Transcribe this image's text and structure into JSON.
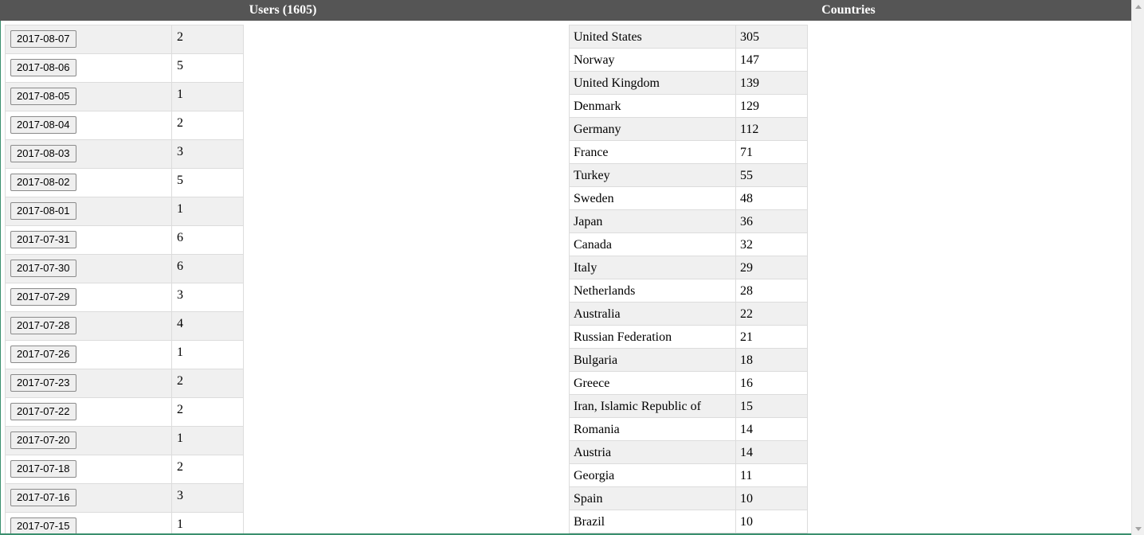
{
  "header": {
    "users_title": "Users (1605)",
    "countries_title": "Countries"
  },
  "users": [
    {
      "date": "2017-08-07",
      "count": "2"
    },
    {
      "date": "2017-08-06",
      "count": "5"
    },
    {
      "date": "2017-08-05",
      "count": "1"
    },
    {
      "date": "2017-08-04",
      "count": "2"
    },
    {
      "date": "2017-08-03",
      "count": "3"
    },
    {
      "date": "2017-08-02",
      "count": "5"
    },
    {
      "date": "2017-08-01",
      "count": "1"
    },
    {
      "date": "2017-07-31",
      "count": "6"
    },
    {
      "date": "2017-07-30",
      "count": "6"
    },
    {
      "date": "2017-07-29",
      "count": "3"
    },
    {
      "date": "2017-07-28",
      "count": "4"
    },
    {
      "date": "2017-07-26",
      "count": "1"
    },
    {
      "date": "2017-07-23",
      "count": "2"
    },
    {
      "date": "2017-07-22",
      "count": "2"
    },
    {
      "date": "2017-07-20",
      "count": "1"
    },
    {
      "date": "2017-07-18",
      "count": "2"
    },
    {
      "date": "2017-07-16",
      "count": "3"
    },
    {
      "date": "2017-07-15",
      "count": "1"
    }
  ],
  "countries": [
    {
      "name": "United States",
      "count": "305"
    },
    {
      "name": "Norway",
      "count": "147"
    },
    {
      "name": "United Kingdom",
      "count": "139"
    },
    {
      "name": "Denmark",
      "count": "129"
    },
    {
      "name": "Germany",
      "count": "112"
    },
    {
      "name": "France",
      "count": "71"
    },
    {
      "name": "Turkey",
      "count": "55"
    },
    {
      "name": "Sweden",
      "count": "48"
    },
    {
      "name": "Japan",
      "count": "36"
    },
    {
      "name": "Canada",
      "count": "32"
    },
    {
      "name": "Italy",
      "count": "29"
    },
    {
      "name": "Netherlands",
      "count": "28"
    },
    {
      "name": "Australia",
      "count": "22"
    },
    {
      "name": "Russian Federation",
      "count": "21"
    },
    {
      "name": "Bulgaria",
      "count": "18"
    },
    {
      "name": "Greece",
      "count": "16"
    },
    {
      "name": "Iran, Islamic Republic of",
      "count": "15"
    },
    {
      "name": "Romania",
      "count": "14"
    },
    {
      "name": "Austria",
      "count": "14"
    },
    {
      "name": "Georgia",
      "count": "11"
    },
    {
      "name": "Spain",
      "count": "10"
    },
    {
      "name": "Brazil",
      "count": "10"
    }
  ],
  "colors": {
    "header_bg": "#555555",
    "row_alt": "#f0f0f0"
  },
  "icons": {
    "scroll_up": "scroll-up-arrow-icon",
    "scroll_down": "scroll-down-arrow-icon"
  }
}
